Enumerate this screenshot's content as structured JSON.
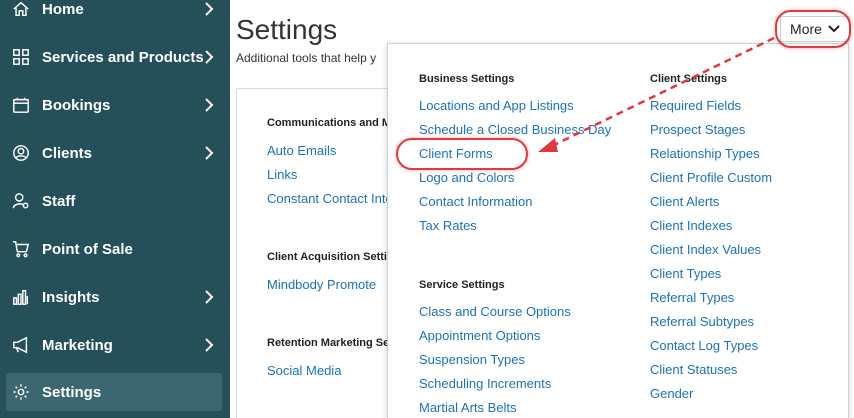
{
  "sidebar": {
    "items": [
      {
        "label": "Home",
        "icon": "home-icon"
      },
      {
        "label": "Services and Products",
        "icon": "grid-icon"
      },
      {
        "label": "Bookings",
        "icon": "calendar-icon"
      },
      {
        "label": "Clients",
        "icon": "user-circle-icon"
      },
      {
        "label": "Staff",
        "icon": "staff-icon"
      },
      {
        "label": "Point of Sale",
        "icon": "cart-icon"
      },
      {
        "label": "Insights",
        "icon": "bar-chart-icon"
      },
      {
        "label": "Marketing",
        "icon": "megaphone-icon"
      },
      {
        "label": "Settings",
        "icon": "gear-icon"
      }
    ],
    "active": "Settings",
    "colors": {
      "background": "#25505a",
      "active": "#3c6670"
    }
  },
  "main": {
    "title": "Settings",
    "subtitle": "Additional tools that help y",
    "more_label": "More",
    "sections": [
      {
        "heading": "Communications and M",
        "links": [
          "Auto Emails",
          "Links",
          "Constant Contact Inte"
        ]
      },
      {
        "heading": "Client Acquisition Setti",
        "links": [
          "Mindbody Promote"
        ]
      },
      {
        "heading": "Retention Marketing Se",
        "links": [
          "Social Media"
        ]
      }
    ]
  },
  "dropdown": {
    "business": {
      "heading": "Business Settings",
      "links": [
        "Locations and App Listings",
        "Schedule a Closed Business Day",
        "Client Forms",
        "Logo and Colors",
        "Contact Information",
        "Tax Rates"
      ]
    },
    "service": {
      "heading": "Service Settings",
      "links": [
        "Class and Course Options",
        "Appointment Options",
        "Suspension Types",
        "Scheduling Increments",
        "Martial Arts Belts"
      ]
    },
    "client": {
      "heading": "Client Settings",
      "links": [
        "Required Fields",
        "Prospect Stages",
        "Relationship Types",
        "Client Profile Custom",
        "Client Alerts",
        "Client Indexes",
        "Client Index Values",
        "Client Types",
        "Referral Types",
        "Referral Subtypes",
        "Contact Log Types",
        "Client Statuses",
        "Gender"
      ]
    },
    "colors": {
      "link": "#1a73b8",
      "annotation": "#e0393e"
    }
  }
}
